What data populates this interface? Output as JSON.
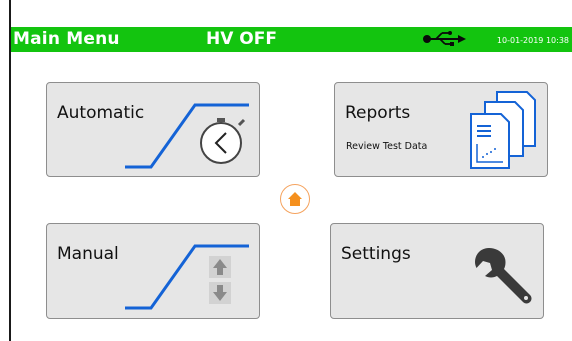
{
  "header": {
    "title": "Main Menu",
    "hv_status": "HV OFF",
    "usb_icon": "usb-icon",
    "datetime": "10-01-2019 10:38",
    "background_color": "#13c40f"
  },
  "tiles": {
    "automatic": {
      "label": "Automatic",
      "icon": "stopwatch-ramp-icon"
    },
    "reports": {
      "label": "Reports",
      "sublabel": "Review Test Data",
      "icon": "documents-chart-icon"
    },
    "manual": {
      "label": "Manual",
      "icon": "ramp-up-down-arrows-icon"
    },
    "settings": {
      "label": "Settings",
      "icon": "wrench-icon"
    }
  },
  "home": {
    "icon": "home-icon",
    "color": "#f5901e"
  },
  "colors": {
    "accent_blue": "#1463d6",
    "tile_bg": "#e6e6e6"
  }
}
